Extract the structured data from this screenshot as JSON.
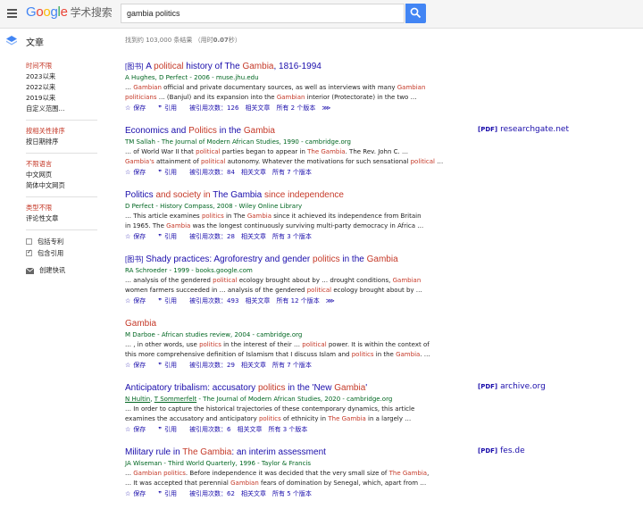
{
  "header": {
    "logo_letters": [
      "G",
      "o",
      "o",
      "g",
      "l",
      "e"
    ],
    "logo_suffix": "学术搜索",
    "search_value": "gambia politics"
  },
  "section": {
    "title": "文章",
    "count_prefix": "找到约 103,000 条结果 （用时",
    "count_time": "0.07",
    "count_suffix": "秒）"
  },
  "sidebar": {
    "time_group": [
      "时间不限",
      "2023以来",
      "2022以来",
      "2019以来",
      "自定义范围..."
    ],
    "sort_group": [
      "按相关性排序",
      "按日期排序"
    ],
    "lang_group": [
      "不限语言",
      "中文网页",
      "简体中文网页"
    ],
    "type_group": [
      "类型不限",
      "评论性文章"
    ],
    "include_patents": "包括专利",
    "include_citations": "包含引用",
    "create_alert": "创建快讯"
  },
  "actions": {
    "save": "保存",
    "cite": "引用",
    "related": "相关文章"
  },
  "results": [
    {
      "tag": "[图书]",
      "title_parts": [
        " A ",
        "political",
        " history of The ",
        "Gambia",
        ", 1816-1994"
      ],
      "authors": "A Hughes, D Perfect - 2006 - muse.jhu.edu",
      "snippet1": [
        [
          "… ",
          false
        ],
        [
          "Gambian",
          true
        ],
        [
          " official and private documentary sources, as well as interviews with many ",
          false
        ],
        [
          "Gambian",
          true
        ]
      ],
      "snippet2": [
        [
          "politicians",
          true
        ],
        [
          " … (Banjul) and its expansion into the ",
          false
        ],
        [
          "Gambian",
          true
        ],
        [
          " interior (Protectorate) in the two …",
          false
        ]
      ],
      "cited": "被引用次数：126",
      "versions": "所有 2 个版本",
      "pdf_label": "",
      "pdf_site": ""
    },
    {
      "tag": "",
      "title_parts": [
        "Economics and ",
        "Politics",
        " in the ",
        "Gambia",
        ""
      ],
      "authors": "TM Sallah - The Journal of Modern African Studies, 1990 - cambridge.org",
      "snippet1": [
        [
          "… of World War II that ",
          false
        ],
        [
          "political",
          true
        ],
        [
          " parties began to appear in ",
          false
        ],
        [
          "The Gambia",
          true
        ],
        [
          ". The Rev. John C. …",
          false
        ]
      ],
      "snippet2": [
        [
          "Gambia's",
          true
        ],
        [
          " attainment of ",
          false
        ],
        [
          "political",
          true
        ],
        [
          " autonomy. Whatever the motivations for such sensational ",
          false
        ],
        [
          "political",
          true
        ],
        [
          " …",
          false
        ]
      ],
      "cited": "被引用次数：84",
      "versions": "所有 7 个版本",
      "pdf_label": "[PDF]",
      "pdf_site": "researchgate.net"
    },
    {
      "tag": "",
      "title_parts": [
        "Politics",
        " and society in ",
        "The Gambia",
        " since independence",
        ""
      ],
      "authors": "D Perfect - History Compass, 2008 - Wiley Online Library",
      "snippet1": [
        [
          "… This article examines ",
          false
        ],
        [
          "politics",
          true
        ],
        [
          " in The ",
          false
        ],
        [
          "Gambia",
          true
        ],
        [
          " since it achieved its independence from Britain",
          false
        ]
      ],
      "snippet2": [
        [
          "in 1965. The ",
          false
        ],
        [
          "Gambia",
          true
        ],
        [
          " was the longest continuously surviving multi-party democracy in Africa …",
          false
        ]
      ],
      "cited": "被引用次数：28",
      "versions": "所有 3 个版本",
      "pdf_label": "",
      "pdf_site": ""
    },
    {
      "tag": "[图书]",
      "title_parts": [
        " Shady practices: Agroforestry and gender ",
        "politics",
        " in the ",
        "Gambia",
        ""
      ],
      "authors": "RA Schroeder - 1999 - books.google.com",
      "snippet1": [
        [
          "… analysis of the gendered ",
          false
        ],
        [
          "political",
          true
        ],
        [
          " ecology brought about by … drought conditions, ",
          false
        ],
        [
          "Gambian",
          true
        ]
      ],
      "snippet2": [
        [
          "women farmers succeeded in … analysis of the gendered ",
          false
        ],
        [
          "political",
          true
        ],
        [
          " ecology brought about by …",
          false
        ]
      ],
      "cited": "被引用次数：493",
      "versions": "所有 12 个版本",
      "pdf_label": "",
      "pdf_site": ""
    },
    {
      "tag": "",
      "title_parts": [
        "",
        "Gambia",
        "",
        "",
        ""
      ],
      "authors": "M Darboe - African studies review, 2004 - cambridge.org",
      "snippet1": [
        [
          "… , in other words, use ",
          false
        ],
        [
          "politics",
          true
        ],
        [
          " in the interest of their … ",
          false
        ],
        [
          "political",
          true
        ],
        [
          " power. It is within the context of",
          false
        ]
      ],
      "snippet2": [
        [
          "this more comprehensive definition of Islamism that I discuss Islam and ",
          false
        ],
        [
          "politics",
          true
        ],
        [
          " in the ",
          false
        ],
        [
          "Gambia",
          true
        ],
        [
          ". …",
          false
        ]
      ],
      "cited": "被引用次数：29",
      "versions": "所有 7 个版本",
      "pdf_label": "",
      "pdf_site": ""
    },
    {
      "tag": "",
      "title_parts": [
        "Anticipatory tribalism: accusatory ",
        "politics",
        " in the 'New ",
        "Gambia",
        "'"
      ],
      "authors_u1": "N Hultin",
      "authors_sep": ", ",
      "authors_u2": "T Sommerfelt",
      "authors_rest": " - The Journal of Modern African Studies, 2020 - cambridge.org",
      "snippet1": [
        [
          "… In order to capture the historical trajectories of these contemporary dynamics, this article",
          false
        ]
      ],
      "snippet2": [
        [
          "examines the accusatory and anticipatory ",
          false
        ],
        [
          "politics",
          true
        ],
        [
          " of ethnicity in ",
          false
        ],
        [
          "The Gambia",
          true
        ],
        [
          " in a largely …",
          false
        ]
      ],
      "cited": "被引用次数：6",
      "versions": "所有 3 个版本",
      "pdf_label": "[PDF]",
      "pdf_site": "archive.org"
    },
    {
      "tag": "",
      "title_parts": [
        "Military rule in ",
        "The Gambia",
        ": an interim assessment",
        "",
        ""
      ],
      "authors": "JA Wiseman - Third World Quarterly, 1996 - Taylor & Francis",
      "snippet1": [
        [
          "… ",
          false
        ],
        [
          "Gambian politics",
          true
        ],
        [
          ". Before independence it was decided that the very small size of ",
          false
        ],
        [
          "The Gambia",
          true
        ],
        [
          ",",
          false
        ]
      ],
      "snippet2": [
        [
          "… It was accepted that perennial ",
          false
        ],
        [
          "Gambian",
          true
        ],
        [
          " fears of domination by Senegal, which, apart from …",
          false
        ]
      ],
      "cited": "被引用次数：62",
      "versions": "所有 5 个版本",
      "pdf_label": "[PDF]",
      "pdf_site": "fes.de"
    }
  ]
}
